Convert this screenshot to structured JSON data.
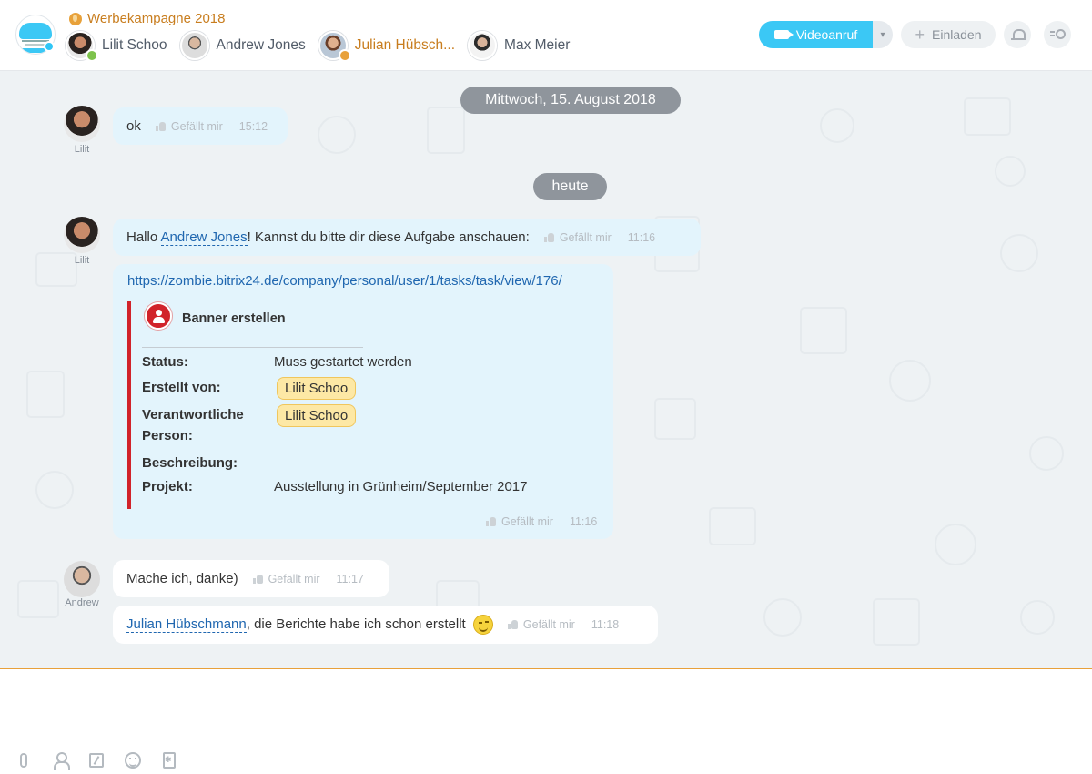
{
  "header": {
    "chat_title": "Werbekampagne 2018",
    "members": [
      {
        "name": "Lilit Schoo",
        "avatar": "lilit"
      },
      {
        "name": "Andrew Jones",
        "avatar": "andrew"
      },
      {
        "name": "Julian Hübsch...",
        "avatar": "julian",
        "active": true
      },
      {
        "name": "Max Meier",
        "avatar": "max"
      }
    ],
    "video_call_label": "Videoanruf",
    "invite_label": "Einladen"
  },
  "dates": {
    "first": "Mittwoch, 15. August 2018",
    "second": "heute"
  },
  "messages": {
    "m1": {
      "author_label": "Lilit",
      "text": "ok",
      "like": "Gefällt mir",
      "time": "15:12"
    },
    "m2": {
      "author_label": "Lilit",
      "prefix": "Hallo ",
      "mention": "Andrew Jones",
      "suffix": "! Kannst du bitte dir diese Aufgabe anschauen:",
      "like": "Gefällt mir",
      "time": "11:16"
    },
    "m3": {
      "link": "https://zombie.bitrix24.de/company/personal/user/1/tasks/task/view/176/",
      "task_title": "Banner erstellen",
      "fields": {
        "status_label": "Status:",
        "status_value": "Muss gestartet werden",
        "created_label": "Erstellt von:",
        "created_value": "Lilit Schoo",
        "responsible_label_1": "Verantwortliche",
        "responsible_label_2": "Person:",
        "responsible_value": "Lilit Schoo",
        "description_label": "Beschreibung:",
        "project_label": "Projekt:",
        "project_value": "Ausstellung in Grünheim/September 2017"
      },
      "like": "Gefällt mir",
      "time": "11:16"
    },
    "m4": {
      "author_label": "Andrew",
      "text": "Mache ich, danke)",
      "like": "Gefällt mir",
      "time": "11:17"
    },
    "m5": {
      "mention": "Julian Hübschmann",
      "text": ", die Berichte habe ich schon erstellt",
      "like": "Gefällt mir",
      "time": "11:18"
    }
  },
  "colors": {
    "accent_blue": "#3bc8f5",
    "title_orange": "#c87d1e",
    "task_red": "#d1232a",
    "link_blue": "#2067b0"
  },
  "composer_tools": [
    "paperclip-icon",
    "user-icon",
    "edit-icon",
    "smile-icon",
    "document-icon"
  ]
}
